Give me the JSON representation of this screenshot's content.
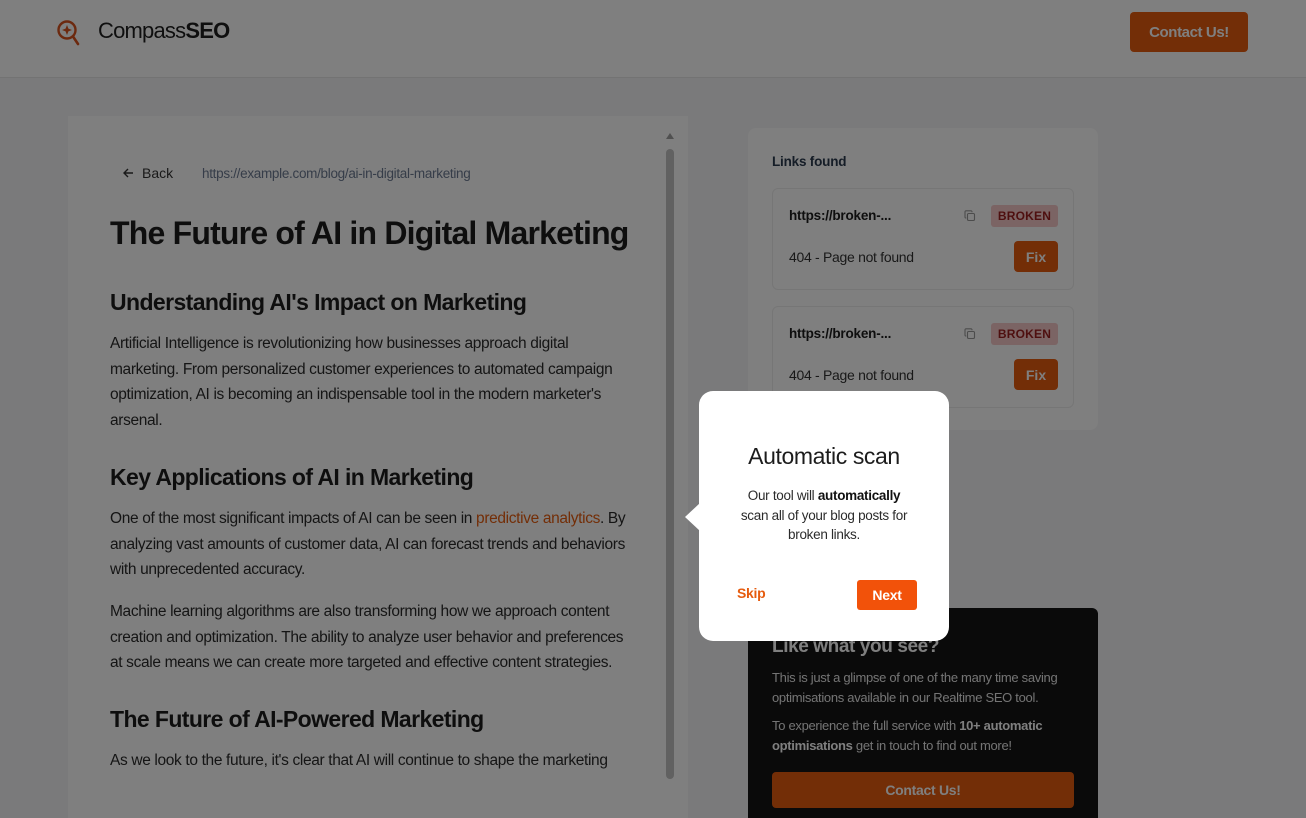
{
  "header": {
    "logo_icon": "magnifier-compass-icon",
    "logo_light": "Compass",
    "logo_bold": "SEO",
    "contact_label": "Contact Us!"
  },
  "article": {
    "back_label": "Back",
    "url": "https://example.com/blog/ai-in-digital-marketing",
    "title": "The Future of AI in Digital Marketing",
    "sections": [
      {
        "heading": "Understanding AI's Impact on Marketing",
        "paragraphs": [
          "Artificial Intelligence is revolutionizing how businesses approach digital marketing. From personalized customer experiences to automated campaign optimization, AI is becoming an indispensable tool in the modern marketer's arsenal."
        ]
      },
      {
        "heading": "Key Applications of AI in Marketing",
        "p1_before": "One of the most significant impacts of AI can be seen in ",
        "p1_link": "predictive analytics",
        "p1_after": ". By analyzing vast amounts of customer data, AI can forecast trends and behaviors with unprecedented accuracy.",
        "p2": "Machine learning algorithms are also transforming how we approach content creation and optimization. The ability to analyze user behavior and preferences at scale means we can create more targeted and effective content strategies."
      },
      {
        "heading": "The Future of AI-Powered Marketing",
        "paragraphs": [
          "As we look to the future, it's clear that AI will continue to shape the marketing"
        ]
      }
    ]
  },
  "links_panel": {
    "heading": "Links found",
    "items": [
      {
        "url": "https://broken-...",
        "badge": "BROKEN",
        "status": "404 - Page not found",
        "fix_label": "Fix"
      },
      {
        "url": "https://broken-...",
        "badge": "BROKEN",
        "status": "404 - Page not found",
        "fix_label": "Fix"
      }
    ]
  },
  "promo": {
    "title": "Like what you see?",
    "text1": "This is just a glimpse of one of the many time saving optimisations available in our Realtime SEO tool.",
    "text2_before": "To experience the full service with ",
    "text2_bold": "10+ automatic optimisations",
    "text2_after": " get in touch to find out more!",
    "button_label": "Contact Us!"
  },
  "tour": {
    "title": "Automatic scan",
    "text_before": "Our tool will ",
    "text_bold": "automatically",
    "text_after": " scan all of your blog posts for broken links.",
    "skip_label": "Skip",
    "next_label": "Next"
  },
  "colors": {
    "accent": "#e65c0f",
    "badge_bg": "#f7c9c9",
    "badge_text": "#9c1f1f",
    "promo_bg": "#141414"
  }
}
